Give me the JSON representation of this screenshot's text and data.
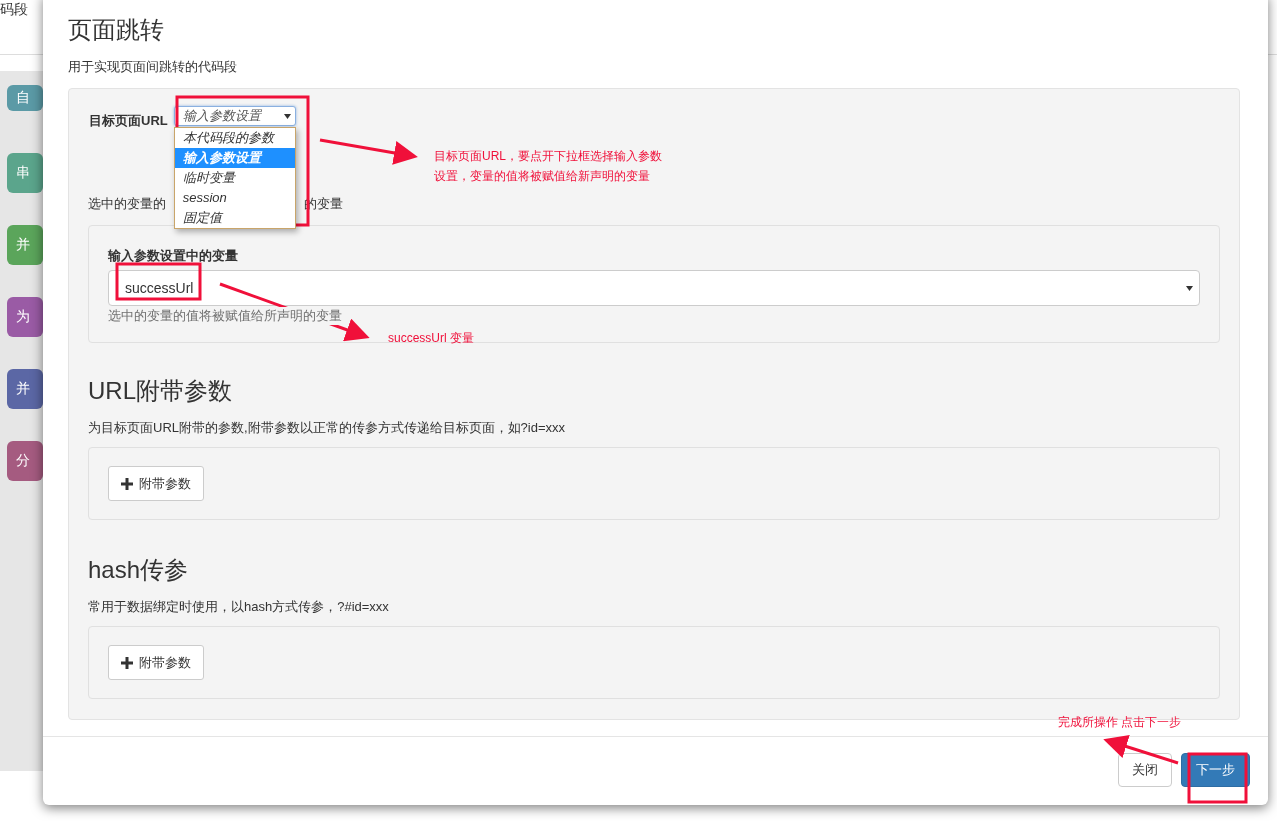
{
  "background": {
    "title": "码段",
    "blocks": [
      {
        "label": "自",
        "color": "#5b9aa6"
      },
      {
        "label": "串",
        "color": "#5ba58c"
      },
      {
        "label": "并",
        "color": "#5ba55b"
      },
      {
        "label": "为",
        "color": "#9a5ba5"
      },
      {
        "label": "并",
        "color": "#5b67a5"
      },
      {
        "label": "分",
        "color": "#a55b80"
      }
    ]
  },
  "dialog": {
    "title": "页面跳转",
    "description": "用于实现页面间跳转的代码段",
    "target_url": {
      "label": "目标页面URL",
      "value": "输入参数设置",
      "expanded": true,
      "options": [
        {
          "label": "本代码段的参数",
          "selected": false
        },
        {
          "label": "输入参数设置",
          "selected": true
        },
        {
          "label": "临时变量",
          "selected": false
        },
        {
          "label": "session",
          "selected": false
        },
        {
          "label": "固定值",
          "selected": false
        }
      ]
    },
    "target_hint": [
      "选中的变量的",
      "的变量"
    ],
    "variable_panel": {
      "label": "输入参数设置中的变量",
      "value": "successUrl",
      "help": "选中的变量的值将被赋值给所声明的变量"
    },
    "sections": [
      {
        "title": "URL附带参数",
        "description": "为目标页面URL附带的参数,附带参数以正常的传参方式传递给目标页面，如?id=xxx",
        "button": "附带参数"
      },
      {
        "title": "hash传参",
        "description": "常用于数据绑定时使用，以hash方式传参，?#id=xxx",
        "button": "附带参数"
      }
    ],
    "buttons": [
      {
        "label": "关闭",
        "kind": "default"
      },
      {
        "label": "下一步",
        "kind": "primary"
      }
    ]
  },
  "annotations": [
    {
      "text": "目标页面URL，要点开下拉框选择输入参数设置，变量的值将被赋值给新声明的变量"
    },
    {
      "text": "successUrl 变量"
    },
    {
      "text": "完成所操作 点击下一步"
    }
  ]
}
